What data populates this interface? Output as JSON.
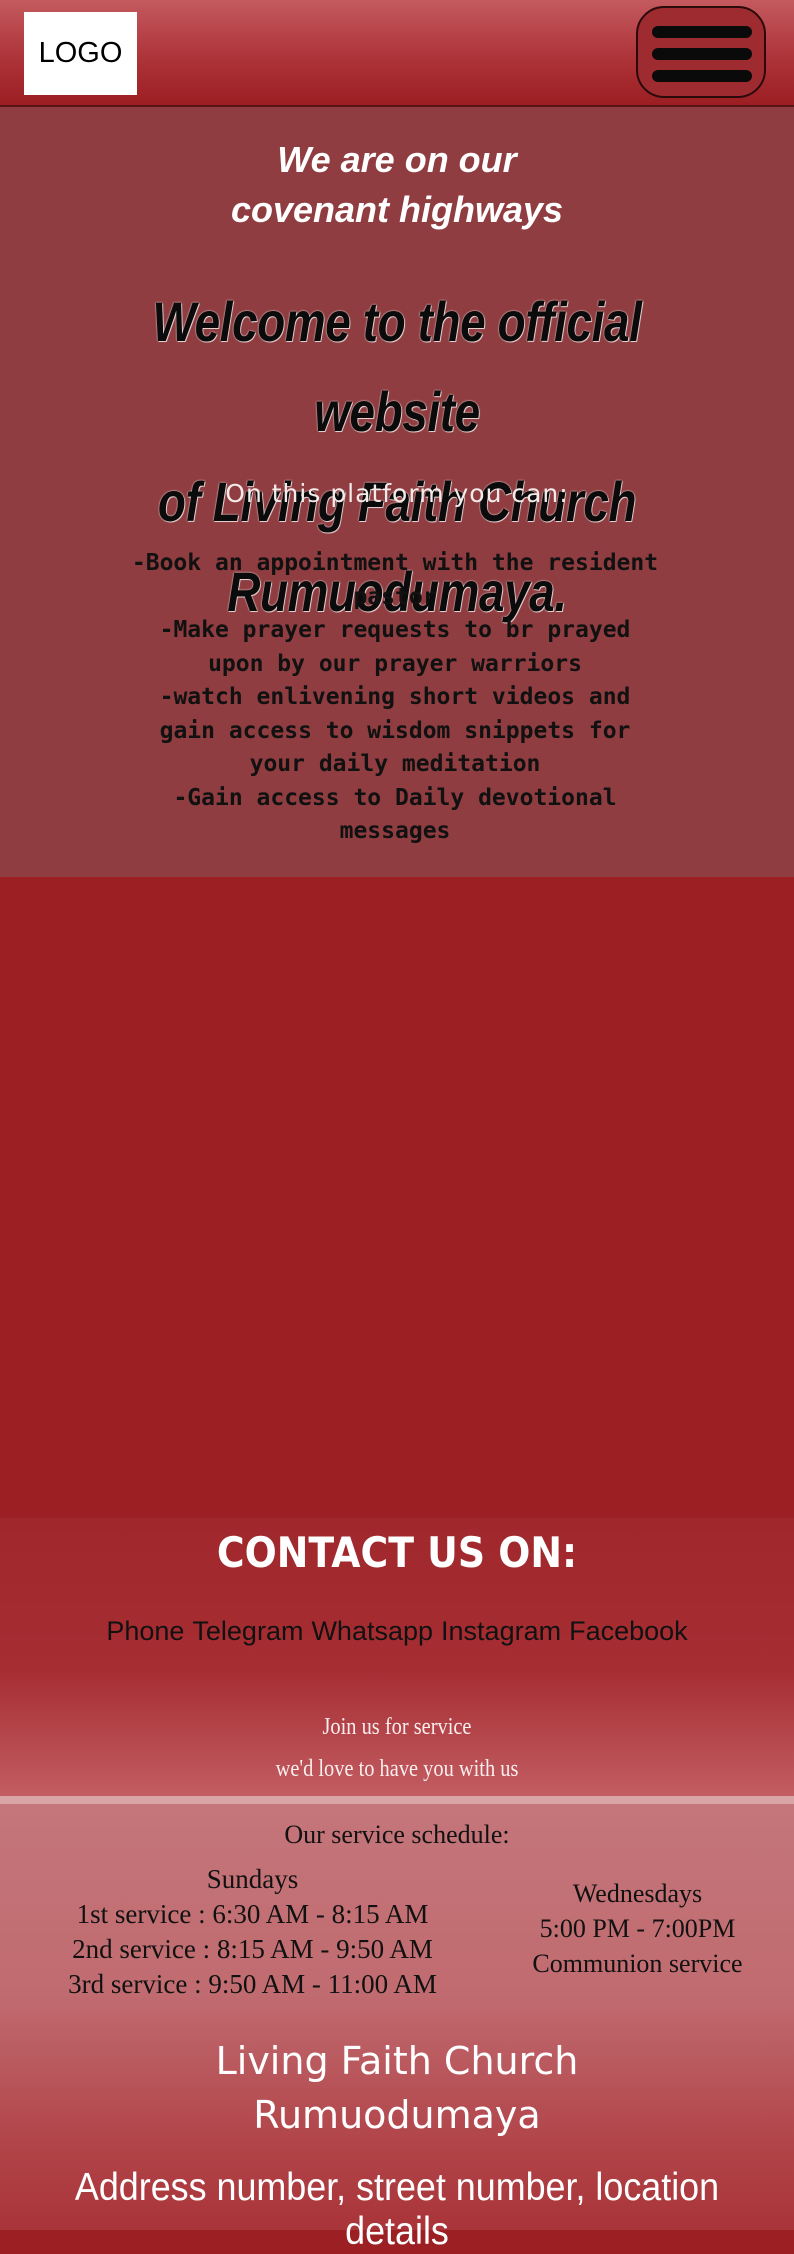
{
  "header": {
    "logo_label": "LOGO",
    "menu_icon": "hamburger-menu-icon"
  },
  "hero": {
    "tagline_line1": "We are on our",
    "tagline_line2": "covenant highways",
    "welcome_line1": "Welcome to the official website",
    "welcome_line2": "of Living Faith Church Rumuodumaya.",
    "platform_intro": "On this platform you can:",
    "features": [
      "-Book an appointment with the resident",
      "pastor",
      "-Make prayer requests to br prayed",
      "upon by our prayer warriors",
      "-watch enlivening short videos and",
      "gain access to wisdom snippets for",
      "your daily meditation",
      "-Gain access to Daily devotional",
      "messages"
    ]
  },
  "contact": {
    "title": "CONTACT US ON:",
    "channels": [
      "Phone",
      "Telegram",
      "Whatsapp",
      "Instagram",
      "Facebook"
    ],
    "join_line1": "Join us for service",
    "join_line2": "we'd love to have you with us"
  },
  "schedule": {
    "title": "Our service schedule:",
    "sundays": {
      "label": "Sundays",
      "services": [
        "1st service : 6:30 AM - 8:15 AM",
        "2nd service : 8:15 AM - 9:50 AM",
        "3rd service : 9:50 AM - 11:00 AM"
      ]
    },
    "wednesdays": {
      "label": "Wednesdays",
      "time": "5:00 PM - 7:00PM",
      "service": "Communion service"
    }
  },
  "footer": {
    "church_line1": "Living Faith Church",
    "church_line2": "Rumuodumaya",
    "address": "Address number, street number, location details"
  },
  "colors": {
    "primary_red": "#9c1f23",
    "hero_bg": "#8f3d40",
    "schedule_bg": "#c4767a",
    "text_light": "#ffffff"
  }
}
